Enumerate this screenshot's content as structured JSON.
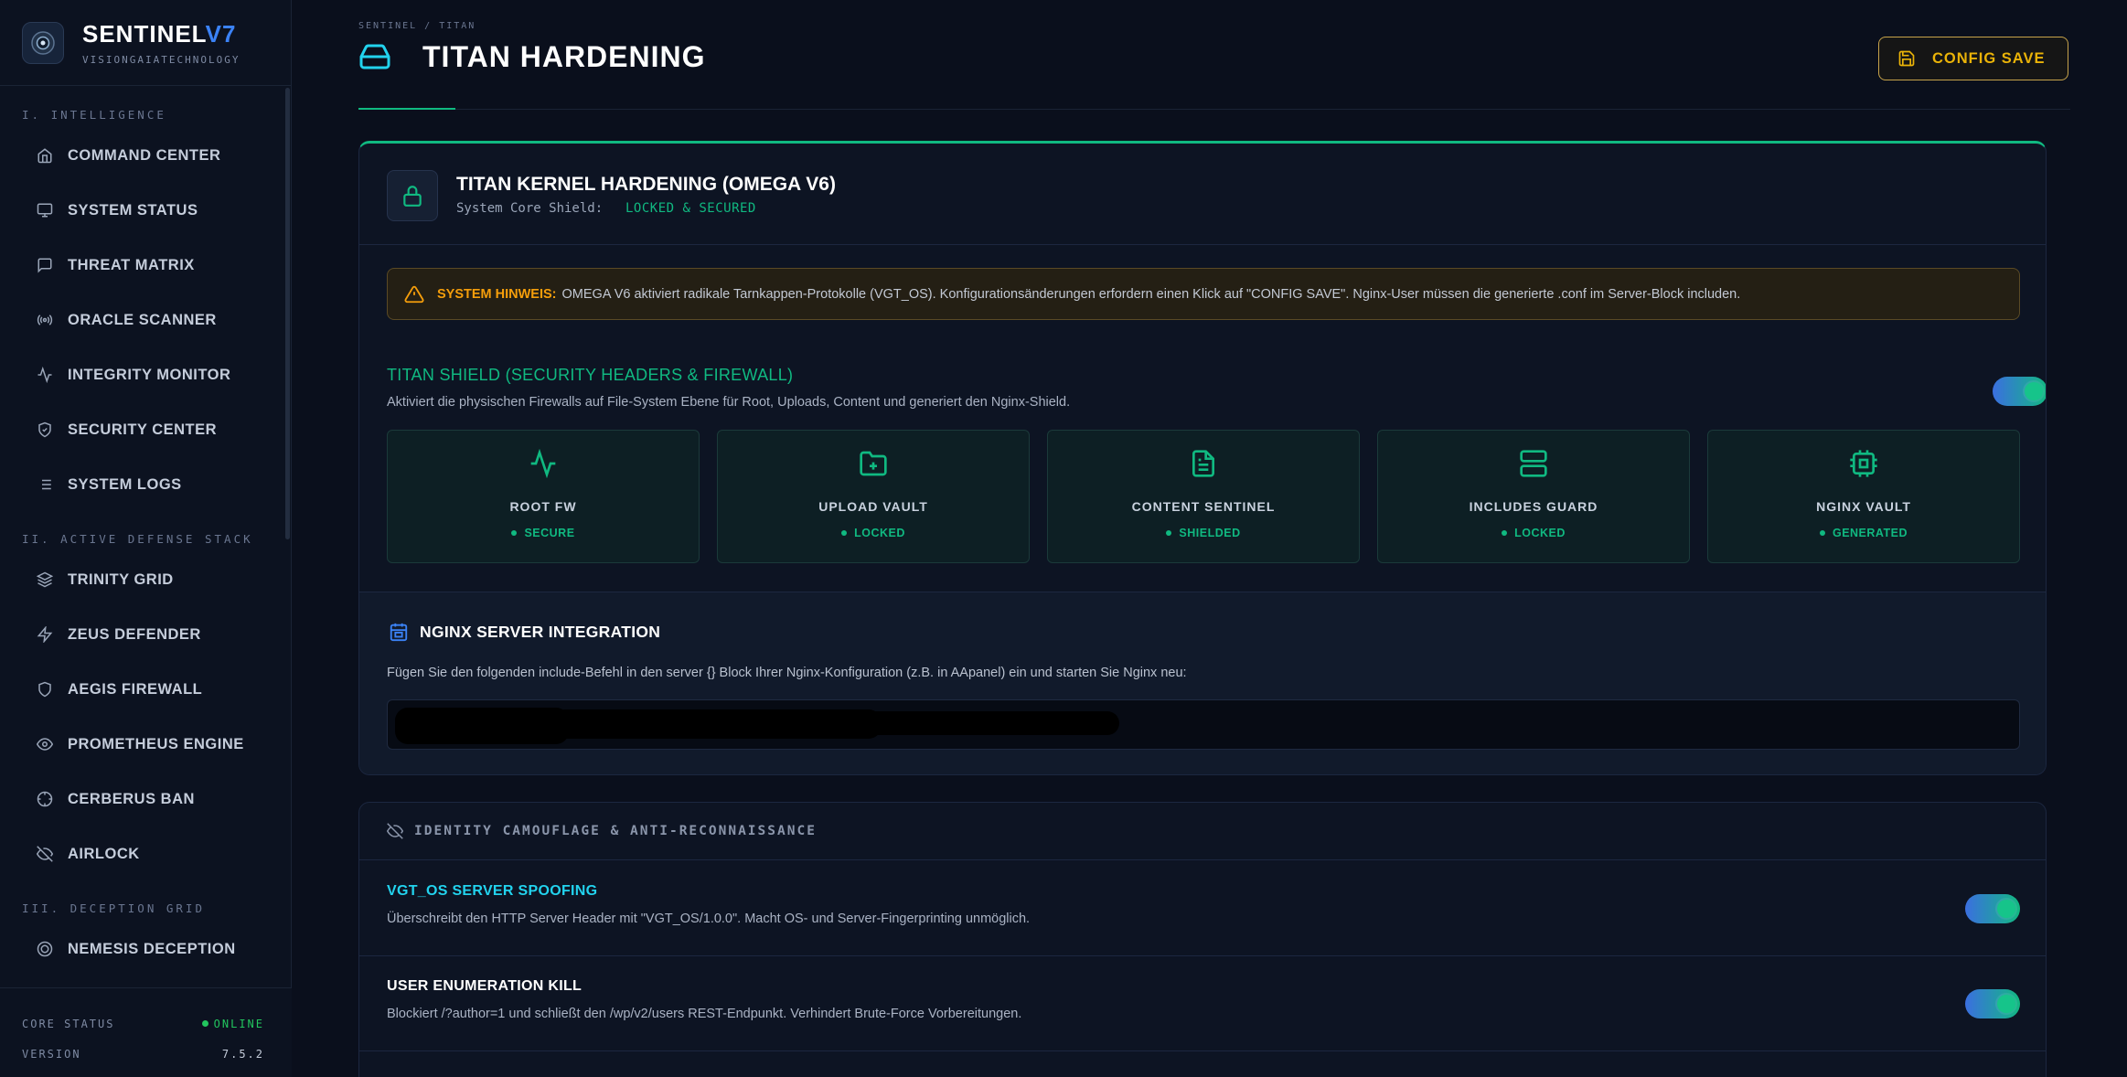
{
  "brand": {
    "name": "SENTINEL",
    "version_mark": "V7",
    "subtitle": "VISIONGAIATECHNOLOGY"
  },
  "sidebar": {
    "sections": [
      {
        "title": "I. INTELLIGENCE",
        "items": [
          {
            "label": "COMMAND CENTER",
            "icon": "home-icon"
          },
          {
            "label": "SYSTEM STATUS",
            "icon": "monitor-icon"
          },
          {
            "label": "THREAT MATRIX",
            "icon": "message-icon"
          },
          {
            "label": "ORACLE SCANNER",
            "icon": "radio-icon"
          },
          {
            "label": "INTEGRITY MONITOR",
            "icon": "activity-icon"
          },
          {
            "label": "SECURITY CENTER",
            "icon": "shield-check-icon"
          },
          {
            "label": "SYSTEM LOGS",
            "icon": "list-icon"
          }
        ]
      },
      {
        "title": "II. ACTIVE DEFENSE STACK",
        "items": [
          {
            "label": "TRINITY GRID",
            "icon": "layers-icon"
          },
          {
            "label": "ZEUS DEFENDER",
            "icon": "zap-icon"
          },
          {
            "label": "AEGIS FIREWALL",
            "icon": "shield-icon"
          },
          {
            "label": "PROMETHEUS ENGINE",
            "icon": "eye-icon"
          },
          {
            "label": "CERBERUS BAN",
            "icon": "crosshair-icon"
          },
          {
            "label": "AIRLOCK",
            "icon": "eye-off-icon"
          }
        ]
      },
      {
        "title": "III. DECEPTION GRID",
        "items": [
          {
            "label": "NEMESIS DECEPTION",
            "icon": "target-icon"
          }
        ]
      }
    ],
    "footer": {
      "core_status_label": "CORE STATUS",
      "core_status_value": "ONLINE",
      "version_label": "VERSION",
      "version_value": "7.5.2"
    }
  },
  "header": {
    "breadcrumb": "SENTINEL / TITAN",
    "title": "TITAN HARDENING",
    "config_save_label": "CONFIG SAVE"
  },
  "titan": {
    "title": "TITAN KERNEL HARDENING (OMEGA V6)",
    "core_label": "System Core Shield:",
    "core_value": "LOCKED & SECURED",
    "notice_label": "SYSTEM HINWEIS:",
    "notice_text": "OMEGA V6 aktiviert radikale Tarnkappen-Protokolle (VGT_OS). Konfigurationsänderungen erfordern einen Klick auf \"CONFIG SAVE\". Nginx-User müssen die generierte .conf im Server-Block includen.",
    "shield_title": "TITAN SHIELD (SECURITY HEADERS & FIREWALL)",
    "shield_desc": "Aktiviert die physischen Firewalls auf File-System Ebene für Root, Uploads, Content und generiert den Nginx-Shield.",
    "shield_enabled": true,
    "tiles": [
      {
        "name": "ROOT FW",
        "status": "SECURE",
        "icon": "activity-icon"
      },
      {
        "name": "UPLOAD VAULT",
        "status": "LOCKED",
        "icon": "folder-plus-icon"
      },
      {
        "name": "CONTENT SENTINEL",
        "status": "SHIELDED",
        "icon": "file-text-icon"
      },
      {
        "name": "INCLUDES GUARD",
        "status": "LOCKED",
        "icon": "server-icon"
      },
      {
        "name": "NGINX VAULT",
        "status": "GENERATED",
        "icon": "cpu-icon"
      }
    ],
    "nginx_title": "NGINX SERVER INTEGRATION",
    "nginx_desc": "Fügen Sie den folgenden include-Befehl in den server {} Block Ihrer Nginx-Konfiguration (z.B. in AApanel) ein und starten Sie Nginx neu:"
  },
  "identity": {
    "title": "IDENTITY CAMOUFLAGE & ANTI-RECONNAISSANCE",
    "options": [
      {
        "title": "VGT_OS SERVER SPOOFING",
        "desc": "Überschreibt den HTTP Server Header mit \"VGT_OS/1.0.0\". Macht OS- und Server-Fingerprinting unmöglich.",
        "enabled": true,
        "color": "#22d3ee"
      },
      {
        "title": "USER ENUMERATION KILL",
        "desc": "Blockiert /?author=1 und schließt den /wp/v2/users REST-Endpunkt. Verhindert Brute-Force Vorbereitungen.",
        "enabled": true,
        "color": "#ffffff"
      }
    ]
  },
  "colors": {
    "accent": "#10b981",
    "brand_blue": "#3b82f6",
    "warning": "#f59e0b",
    "save_gold": "#eab308"
  }
}
